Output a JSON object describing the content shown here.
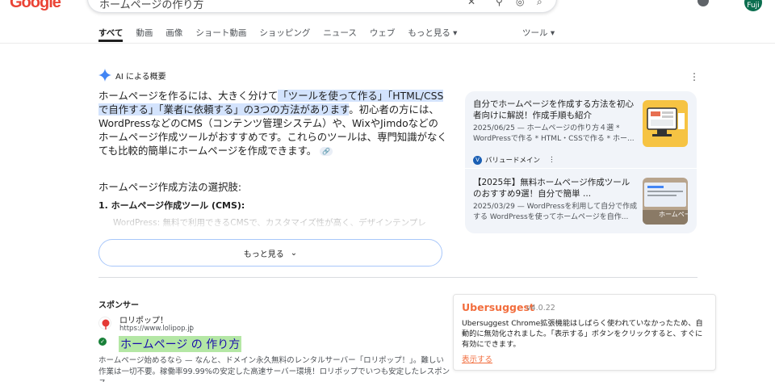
{
  "header": {
    "logo_text": "Google",
    "search_query": "ホームページの作り方",
    "avatar_text": "Fuji"
  },
  "tabs": [
    {
      "label": "すべて",
      "active": true
    },
    {
      "label": "動画"
    },
    {
      "label": "画像"
    },
    {
      "label": "ショート動画"
    },
    {
      "label": "ショッピング"
    },
    {
      "label": "ニュース"
    },
    {
      "label": "ウェブ"
    },
    {
      "label": "もっと見る ▾"
    }
  ],
  "tools_label": "ツール ▾",
  "ai_overview": {
    "heading": "AI による概要",
    "para_1": "ホームページを作るには、大きく分けて",
    "para_hl_1": "「ツールを使って作る」",
    "para_hl_2": "「HTML/CSSで自作する」「業者に依頼する」の3つの方法があります",
    "para_2": "。初心者の方には、WordPressなどのCMS（コンテンツ管理システム）や、WixやJimdoなどのホームページ作成ツールがおすすめです。これらのツールは、専門知識がなくても比較的簡単にホームページを作成できます。",
    "section_title": "ホームページ作成方法の選択肢:",
    "sub_title": "1. ホームページ作成ツール (CMS):",
    "faded_line": "WordPress: 無料で利用できるCMSで、カスタマイズ性が高く、デザインテンプレ",
    "more_label": "もっと見る"
  },
  "side_cards": [
    {
      "title": "自分でホームページを作成する方法を初心者向けに解説！作成手順も紹介",
      "snippet": "2025/06/25 — ホームページの作り方４選 * WordPressで作る * HTML・CSSで作る * ホー...",
      "source": "バリュードメイン"
    },
    {
      "title": "【2025年】無料ホームページ作成ツールのおすすめ9選！自分で簡単 ...",
      "snippet": "2025/03/29 — WordPressを利用して自分で作成する WordPressを使ってホームページを自作...",
      "thumb_text": "ホームペー"
    }
  ],
  "sponsor": {
    "label": "スポンサー",
    "name": "ロリポップ！",
    "url": "https://www.lolipop.jp",
    "title": "ホームページ の 作り方",
    "description": "ホームページ始めるなら — なんと、ドメイン永久無料のレンタルサーバー「ロリポップ！」。難しい作業は一切不要。稼働率99.99%の安定した高速サーバー環境！ロリポップでいつも安定したレスポンス"
  },
  "ubersuggest": {
    "name": "Ubersuggest",
    "version": "v4.0.22",
    "message": "Ubersuggest Chrome拡張機能はしばらく使われていなかったため、自動的に無効化されました。「表示する」ボタンをクリックすると、すぐに有効にできます。",
    "link": "表示する"
  },
  "colors": {
    "highlight": "#d3e3fd",
    "ad_title_highlight": "#b4e7a5",
    "uber_accent": "#f26d3d"
  }
}
